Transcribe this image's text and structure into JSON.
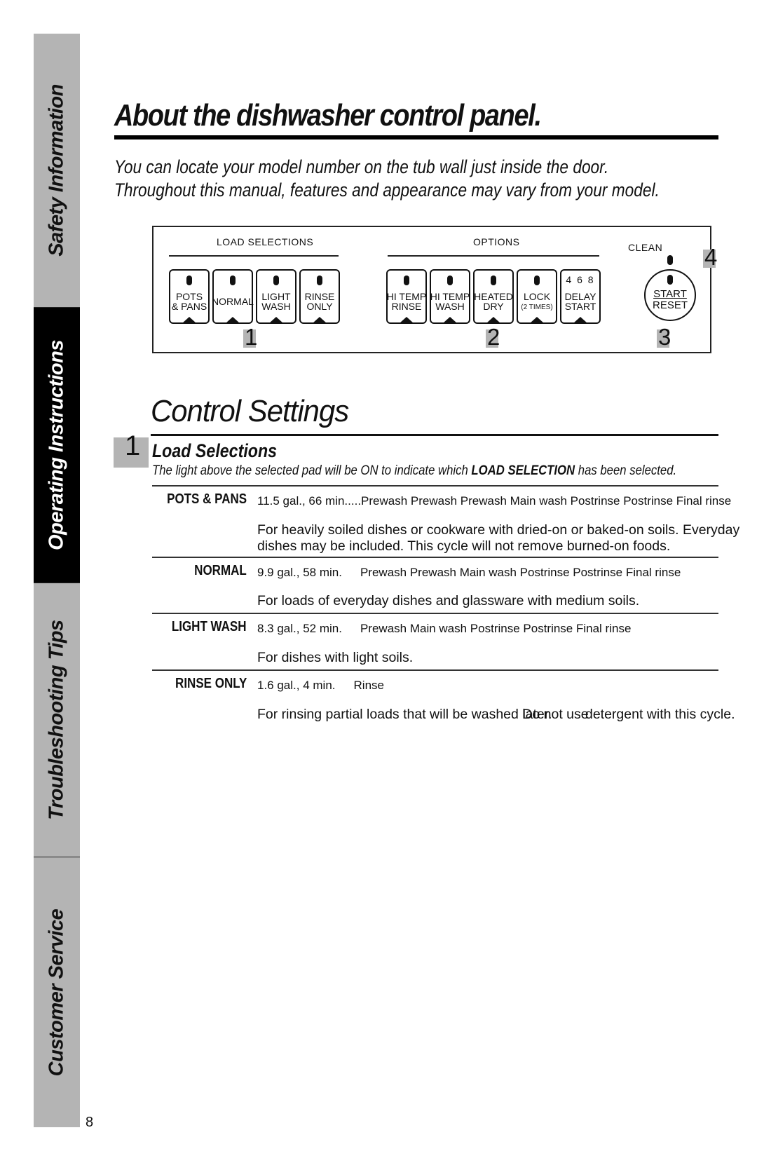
{
  "sidebar": {
    "tabs": [
      {
        "label": "Safety Information",
        "active": false
      },
      {
        "label": "Operating Instructions",
        "active": true
      },
      {
        "label": "Troubleshooting Tips",
        "active": false
      },
      {
        "label": "Customer Service",
        "active": false
      }
    ]
  },
  "page_number": "8",
  "header": {
    "title": "About the dishwasher control panel.",
    "intro_line1": "You can locate your model number on the tub wall just inside the door.",
    "intro_line2": "Throughout this manual, features and appearance may vary from your model."
  },
  "control_panel": {
    "load_group_label": "LOAD SELECTIONS",
    "options_group_label": "OPTIONS",
    "clean_label": "CLEAN",
    "load_pads": [
      {
        "line1": "POTS",
        "line2": "& PANS"
      },
      {
        "line1": "NORMAL",
        "line2": ""
      },
      {
        "line1": "LIGHT",
        "line2": "WASH"
      },
      {
        "line1": "RINSE",
        "line2": "ONLY"
      }
    ],
    "option_pads": [
      {
        "line1": "HI TEMP",
        "line2": "RINSE"
      },
      {
        "line1": "HI TEMP",
        "line2": "WASH"
      },
      {
        "line1": "HEATED",
        "line2": "DRY"
      },
      {
        "line1": "LOCK",
        "line2": "(2 TIMES)"
      },
      {
        "line1": "DELAY",
        "line2": "START",
        "hours": "4 6 8"
      }
    ],
    "start_button": {
      "line1": "START",
      "line2": "RESET"
    },
    "markers": [
      "1",
      "2",
      "3",
      "4"
    ]
  },
  "control_settings": {
    "title": "Control Settings",
    "section_number": "1",
    "section_title": "Load Selections",
    "section_desc_pre": "The light above the selected pad will be ON to indicate which ",
    "section_desc_bold": "LOAD SELECTION",
    "section_desc_post": " has been selected.",
    "cycles": [
      {
        "name": "POTS & PANS",
        "spec": "11.5 gal., 66 min.....",
        "steps": "Prewash Prewash Prewash Main wash Postrinse Postrinse Final rinse",
        "desc_line1": "For heavily soiled dishes or cookware with dried-on or baked-on soils. Everyday",
        "desc_line2": "dishes may be included. This cycle will not remove burned-on foods."
      },
      {
        "name": "NORMAL",
        "spec": "9.9 gal., 58 min.",
        "steps": "Prewash Prewash Main wash Postrinse Postrinse Final rinse",
        "desc_line1": "For loads of everyday dishes and glassware with medium soils."
      },
      {
        "name": "LIGHT WASH",
        "spec": "8.3 gal., 52 min.",
        "steps": "Prewash Main wash Postrinse Postrinse Final rinse",
        "desc_line1": "For dishes with light soils."
      },
      {
        "name": "RINSE ONLY",
        "spec": "1.6 gal.,  4 min.",
        "steps": "Rinse",
        "desc_line1_a": "For rinsing partial loads that will be washed ",
        "desc_line1_b": "later.",
        "desc_line1_c": "Do not use",
        "desc_line1_d": " detergent with this cycle."
      }
    ]
  }
}
